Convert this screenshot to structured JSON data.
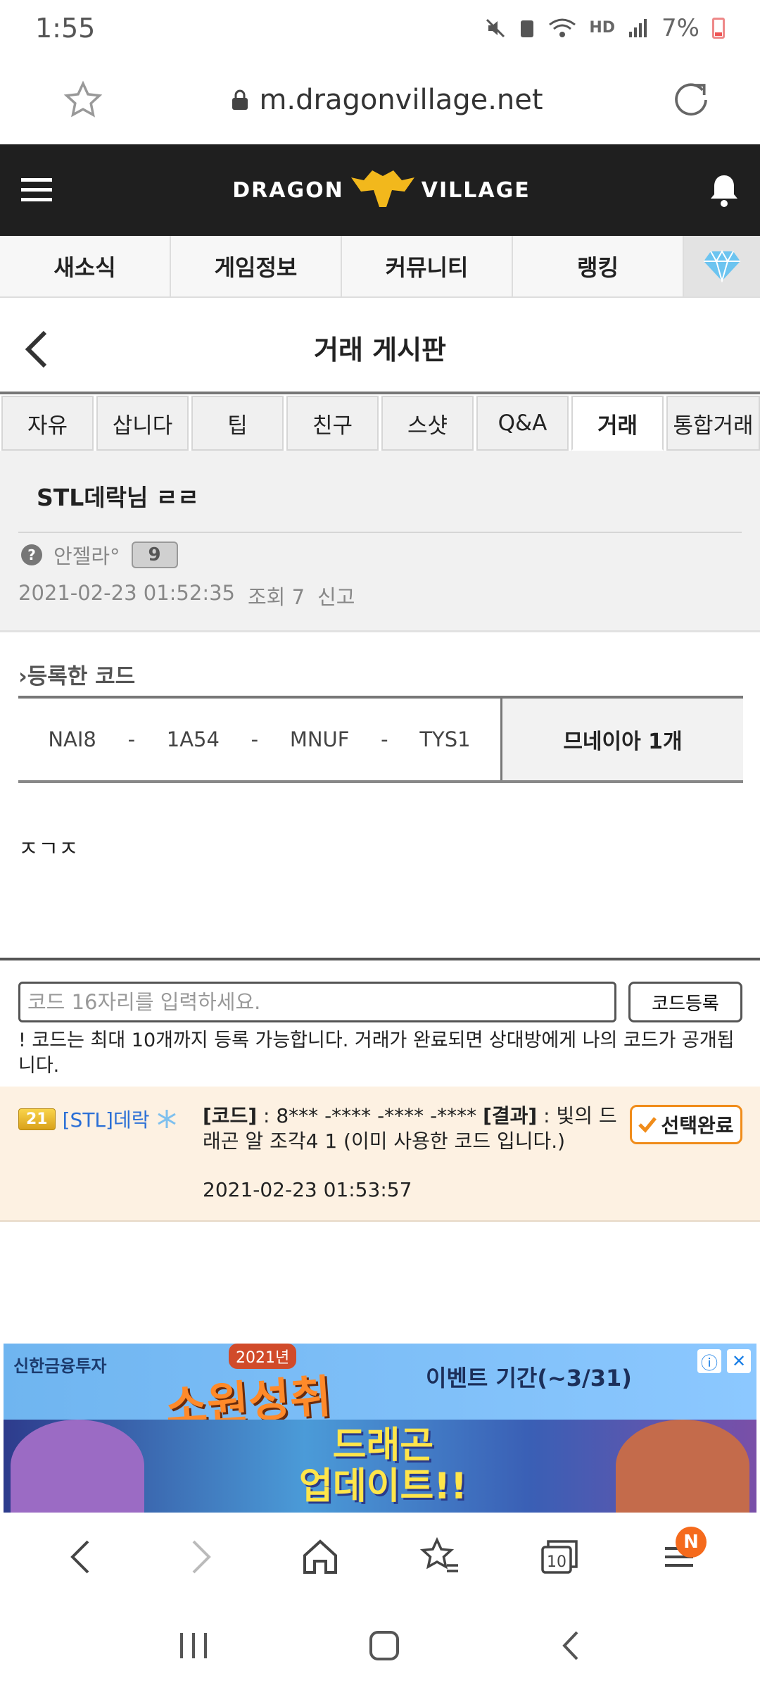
{
  "status": {
    "time": "1:55",
    "battery": "7%"
  },
  "browser": {
    "url": "m.dragonvillage.net"
  },
  "site": {
    "logo_left": "DRAGON",
    "logo_right": "VILLAGE"
  },
  "main_nav": [
    "새소식",
    "게임정보",
    "커뮤니티",
    "랭킹"
  ],
  "page": {
    "title": "거래 게시판"
  },
  "board_tabs": [
    "자유",
    "삽니다",
    "팁",
    "친구",
    "스샷",
    "Q&A",
    "거래",
    "통합거래"
  ],
  "post": {
    "title": "STL데락님 ㄹㄹ",
    "author": "안젤라°",
    "author_level": "9",
    "date": "2021-02-23 01:52:35",
    "views": "조회 7",
    "report": "신고"
  },
  "codes": {
    "heading": "등록한 코드",
    "parts": [
      "NAI8",
      "-",
      "1A54",
      "-",
      "MNUF",
      "-",
      "TYS1"
    ],
    "item": "므네이아 1개"
  },
  "body_text": "ㅈㄱㅈ",
  "comment_input": {
    "placeholder": "코드 16자리를 입력하세요.",
    "register_label": "코드등록",
    "notice": "! 코드는 최대 10개까지 등록 가능합니다. 거래가 완료되면 상대방에게 나의 코드가 공개됩니다."
  },
  "comment": {
    "level": "21",
    "user": "[STL]데락",
    "code_label": "[코드]",
    "code_text": " : 8*** -**** -**** -**** ",
    "result_label": "[결과]",
    "result_text": " : 빛의 드래곤 알 조각4 1 (이미 사용한 코드 입니다.)",
    "time": "2021-02-23 01:53:57",
    "select_label": "선택완료"
  },
  "ad": {
    "brand": "신한금융투자",
    "badge": "2021년",
    "title": "소원성취",
    "event": "이벤트 기간(~3/31)",
    "bottom_line1": "드래곤",
    "bottom_line2": "업데이트!!"
  },
  "browser_nav": {
    "tabs_count": "10",
    "menu_badge": "N"
  }
}
